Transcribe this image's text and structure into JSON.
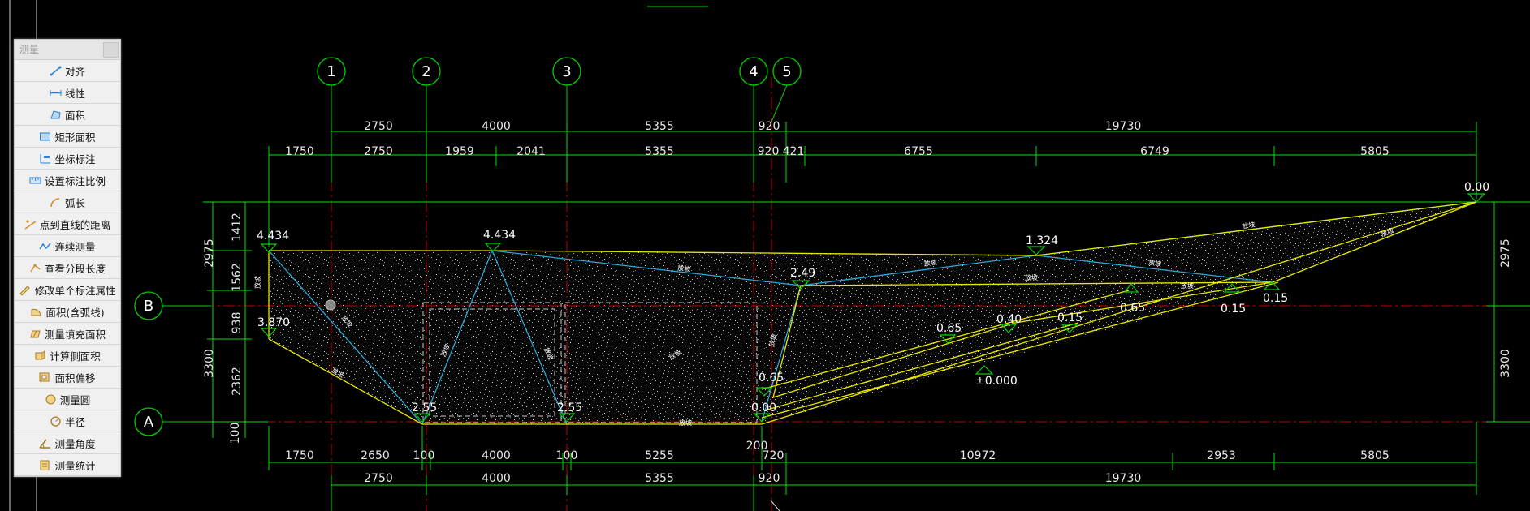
{
  "panel": {
    "title": "测量",
    "tools": [
      {
        "label": "对齐",
        "icon": "align-measure-icon"
      },
      {
        "label": "线性",
        "icon": "linear-measure-icon"
      },
      {
        "label": "面积",
        "icon": "area-icon"
      },
      {
        "label": "矩形面积",
        "icon": "rect-area-icon"
      },
      {
        "label": "坐标标注",
        "icon": "coordinate-icon"
      },
      {
        "label": "设置标注比例",
        "icon": "scale-icon"
      },
      {
        "label": "弧长",
        "icon": "arc-length-icon"
      },
      {
        "label": "点到直线的距离",
        "icon": "point-line-distance-icon"
      },
      {
        "label": "连续测量",
        "icon": "continuous-measure-icon"
      },
      {
        "label": "查看分段长度",
        "icon": "segment-length-icon"
      },
      {
        "label": "修改单个标注属性",
        "icon": "edit-dimension-icon"
      },
      {
        "label": "面积(含弧线)",
        "icon": "arc-area-icon"
      },
      {
        "label": "测量填充面积",
        "icon": "hatch-area-icon"
      },
      {
        "label": "计算侧面积",
        "icon": "side-area-icon"
      },
      {
        "label": "面积偏移",
        "icon": "area-offset-icon"
      },
      {
        "label": "测量圆",
        "icon": "circle-measure-icon"
      },
      {
        "label": "半径",
        "icon": "radius-icon"
      },
      {
        "label": "测量角度",
        "icon": "angle-icon"
      },
      {
        "label": "测量统计",
        "icon": "statistics-icon"
      }
    ]
  },
  "drawing": {
    "axes_vertical": [
      "1",
      "2",
      "3",
      "4",
      "5"
    ],
    "axes_horizontal": [
      "B",
      "A"
    ],
    "dim_top_row1": [
      "2750",
      "4000",
      "5355",
      "920",
      "19730"
    ],
    "dim_top_row2": [
      "1750",
      "2750",
      "1959",
      "2041",
      "5355",
      "920",
      "421",
      "6755",
      "6749",
      "5805"
    ],
    "dim_bottom_row1": [
      "1750",
      "2650",
      "100",
      "4000",
      "100",
      "5255",
      "200",
      "720",
      "10972",
      "2953",
      "5805"
    ],
    "dim_bottom_row2": [
      "2750",
      "4000",
      "5355",
      "920",
      "19730"
    ],
    "dim_left": [
      "2975",
      "1412",
      "1562",
      "938",
      "2362",
      "3300",
      "100"
    ],
    "dim_right": [
      "2975",
      "3300"
    ],
    "elevations": [
      "4.434",
      "4.434",
      "1.324",
      "0.00",
      "2.49",
      "3.870",
      "0.65",
      "0.40",
      "0.15",
      "0.65",
      "0.15",
      "0.15",
      "0.65",
      "±0.000",
      "2.55",
      "2.55",
      "0.00"
    ],
    "slope_label": "放坡"
  },
  "colors": {
    "background": "#000000",
    "axis": "#00d000",
    "dimension": "#00e000",
    "boundary": "#e8e800",
    "slope_line": "#2ea8d6",
    "grid_red": "#c00000"
  }
}
